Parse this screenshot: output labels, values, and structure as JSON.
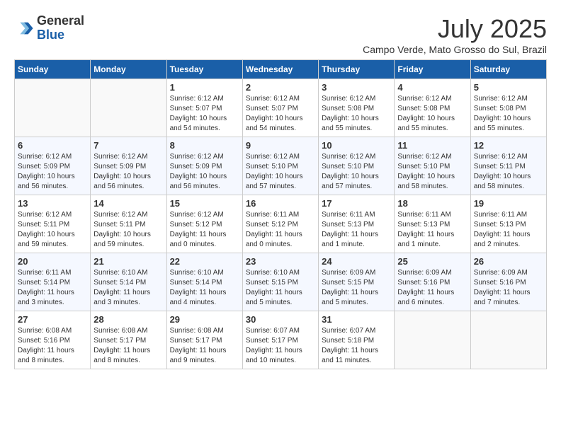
{
  "header": {
    "logo_general": "General",
    "logo_blue": "Blue",
    "month_title": "July 2025",
    "location": "Campo Verde, Mato Grosso do Sul, Brazil"
  },
  "days_of_week": [
    "Sunday",
    "Monday",
    "Tuesday",
    "Wednesday",
    "Thursday",
    "Friday",
    "Saturday"
  ],
  "weeks": [
    [
      {
        "day": "",
        "info": ""
      },
      {
        "day": "",
        "info": ""
      },
      {
        "day": "1",
        "info": "Sunrise: 6:12 AM\nSunset: 5:07 PM\nDaylight: 10 hours\nand 54 minutes."
      },
      {
        "day": "2",
        "info": "Sunrise: 6:12 AM\nSunset: 5:07 PM\nDaylight: 10 hours\nand 54 minutes."
      },
      {
        "day": "3",
        "info": "Sunrise: 6:12 AM\nSunset: 5:08 PM\nDaylight: 10 hours\nand 55 minutes."
      },
      {
        "day": "4",
        "info": "Sunrise: 6:12 AM\nSunset: 5:08 PM\nDaylight: 10 hours\nand 55 minutes."
      },
      {
        "day": "5",
        "info": "Sunrise: 6:12 AM\nSunset: 5:08 PM\nDaylight: 10 hours\nand 55 minutes."
      }
    ],
    [
      {
        "day": "6",
        "info": "Sunrise: 6:12 AM\nSunset: 5:09 PM\nDaylight: 10 hours\nand 56 minutes."
      },
      {
        "day": "7",
        "info": "Sunrise: 6:12 AM\nSunset: 5:09 PM\nDaylight: 10 hours\nand 56 minutes."
      },
      {
        "day": "8",
        "info": "Sunrise: 6:12 AM\nSunset: 5:09 PM\nDaylight: 10 hours\nand 56 minutes."
      },
      {
        "day": "9",
        "info": "Sunrise: 6:12 AM\nSunset: 5:10 PM\nDaylight: 10 hours\nand 57 minutes."
      },
      {
        "day": "10",
        "info": "Sunrise: 6:12 AM\nSunset: 5:10 PM\nDaylight: 10 hours\nand 57 minutes."
      },
      {
        "day": "11",
        "info": "Sunrise: 6:12 AM\nSunset: 5:10 PM\nDaylight: 10 hours\nand 58 minutes."
      },
      {
        "day": "12",
        "info": "Sunrise: 6:12 AM\nSunset: 5:11 PM\nDaylight: 10 hours\nand 58 minutes."
      }
    ],
    [
      {
        "day": "13",
        "info": "Sunrise: 6:12 AM\nSunset: 5:11 PM\nDaylight: 10 hours\nand 59 minutes."
      },
      {
        "day": "14",
        "info": "Sunrise: 6:12 AM\nSunset: 5:11 PM\nDaylight: 10 hours\nand 59 minutes."
      },
      {
        "day": "15",
        "info": "Sunrise: 6:12 AM\nSunset: 5:12 PM\nDaylight: 11 hours\nand 0 minutes."
      },
      {
        "day": "16",
        "info": "Sunrise: 6:11 AM\nSunset: 5:12 PM\nDaylight: 11 hours\nand 0 minutes."
      },
      {
        "day": "17",
        "info": "Sunrise: 6:11 AM\nSunset: 5:13 PM\nDaylight: 11 hours\nand 1 minute."
      },
      {
        "day": "18",
        "info": "Sunrise: 6:11 AM\nSunset: 5:13 PM\nDaylight: 11 hours\nand 1 minute."
      },
      {
        "day": "19",
        "info": "Sunrise: 6:11 AM\nSunset: 5:13 PM\nDaylight: 11 hours\nand 2 minutes."
      }
    ],
    [
      {
        "day": "20",
        "info": "Sunrise: 6:11 AM\nSunset: 5:14 PM\nDaylight: 11 hours\nand 3 minutes."
      },
      {
        "day": "21",
        "info": "Sunrise: 6:10 AM\nSunset: 5:14 PM\nDaylight: 11 hours\nand 3 minutes."
      },
      {
        "day": "22",
        "info": "Sunrise: 6:10 AM\nSunset: 5:14 PM\nDaylight: 11 hours\nand 4 minutes."
      },
      {
        "day": "23",
        "info": "Sunrise: 6:10 AM\nSunset: 5:15 PM\nDaylight: 11 hours\nand 5 minutes."
      },
      {
        "day": "24",
        "info": "Sunrise: 6:09 AM\nSunset: 5:15 PM\nDaylight: 11 hours\nand 5 minutes."
      },
      {
        "day": "25",
        "info": "Sunrise: 6:09 AM\nSunset: 5:16 PM\nDaylight: 11 hours\nand 6 minutes."
      },
      {
        "day": "26",
        "info": "Sunrise: 6:09 AM\nSunset: 5:16 PM\nDaylight: 11 hours\nand 7 minutes."
      }
    ],
    [
      {
        "day": "27",
        "info": "Sunrise: 6:08 AM\nSunset: 5:16 PM\nDaylight: 11 hours\nand 8 minutes."
      },
      {
        "day": "28",
        "info": "Sunrise: 6:08 AM\nSunset: 5:17 PM\nDaylight: 11 hours\nand 8 minutes."
      },
      {
        "day": "29",
        "info": "Sunrise: 6:08 AM\nSunset: 5:17 PM\nDaylight: 11 hours\nand 9 minutes."
      },
      {
        "day": "30",
        "info": "Sunrise: 6:07 AM\nSunset: 5:17 PM\nDaylight: 11 hours\nand 10 minutes."
      },
      {
        "day": "31",
        "info": "Sunrise: 6:07 AM\nSunset: 5:18 PM\nDaylight: 11 hours\nand 11 minutes."
      },
      {
        "day": "",
        "info": ""
      },
      {
        "day": "",
        "info": ""
      }
    ]
  ]
}
